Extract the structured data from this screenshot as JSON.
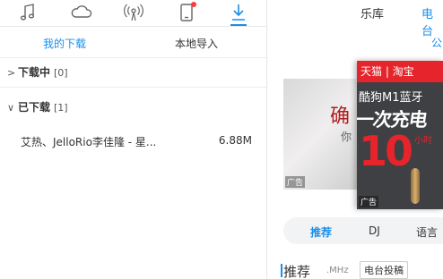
{
  "toolbar": {
    "icons": [
      "music-note-icon",
      "cloud-icon",
      "radio-icon",
      "phone-icon",
      "download-icon"
    ],
    "active": "download-icon",
    "accent": "#1a8ee8",
    "notify_dot_color": "#ff3b3b"
  },
  "download_tabs": [
    {
      "label": "我的下载",
      "active": true
    },
    {
      "label": "本地导入",
      "active": false
    }
  ],
  "sections": {
    "downloading": {
      "arrow": ">",
      "label": "下载中",
      "count": "[0]"
    },
    "downloaded": {
      "arrow": "∨",
      "label": "已下载",
      "count": "[1]"
    }
  },
  "files": [
    {
      "name": "艾热、JelloRio李佳隆 - 星...",
      "size": "6.88M"
    }
  ],
  "right_panel": {
    "tabs": [
      {
        "label": "乐库",
        "active": false
      },
      {
        "label": "电台",
        "active": true
      }
    ],
    "subtab": "公",
    "banner1": {
      "text_large": "确",
      "text_small": "你",
      "ad_label": "广告"
    },
    "banner2": {
      "brand": "天猫 | 淘宝",
      "line1": "酷狗M1蓝牙",
      "line2": "一次充电",
      "number": "10",
      "small": "小时",
      "ad_label": "广告"
    },
    "pills": [
      {
        "label": "推荐",
        "active": true
      },
      {
        "label": "DJ",
        "active": false
      },
      {
        "label": "语言",
        "active": false
      }
    ],
    "section_title": "推荐",
    "section_unit": ".MHz",
    "submit_button": "电台投稿"
  }
}
